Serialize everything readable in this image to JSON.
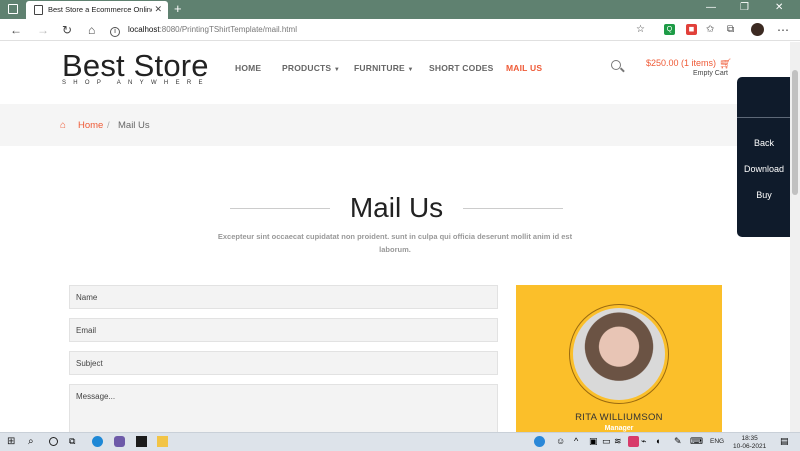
{
  "browser": {
    "tab_title": "Best Store a Ecommerce Online S",
    "url_host": "localhost",
    "url_path": ":8080/PrintingTShirtTemplate/mail.html"
  },
  "header": {
    "logo_main": "Best Store",
    "logo_tagline": "SHOP ANYWHERE",
    "nav": [
      {
        "label": "HOME"
      },
      {
        "label": "PRODUCTS"
      },
      {
        "label": "FURNITURE"
      },
      {
        "label": "SHORT CODES"
      },
      {
        "label": "MAIL US"
      }
    ],
    "cart_price": "$250.00 (1 items)",
    "cart_empty": "Empty Cart"
  },
  "breadcrumb": {
    "home": "Home",
    "separator": "/",
    "current": "Mail Us"
  },
  "section": {
    "title": "Mail Us",
    "subtitle": "Excepteur sint occaecat cupidatat non proident. sunt in culpa qui officia deserunt mollit anim id est laborum."
  },
  "form": {
    "name_placeholder": "Name",
    "email_placeholder": "Email",
    "subject_placeholder": "Subject",
    "message_placeholder": "Message..."
  },
  "profile": {
    "name": "RITA WILLIUMSON",
    "role": "Manager"
  },
  "side_panel": {
    "back": "Back",
    "download": "Download",
    "buy": "Buy"
  },
  "taskbar": {
    "lang": "ENG",
    "time": "18:35",
    "date": "10-06-2021"
  },
  "colors": {
    "accent": "#ef5a36",
    "card": "#fbbf2a",
    "panel": "#0f1b2b"
  }
}
